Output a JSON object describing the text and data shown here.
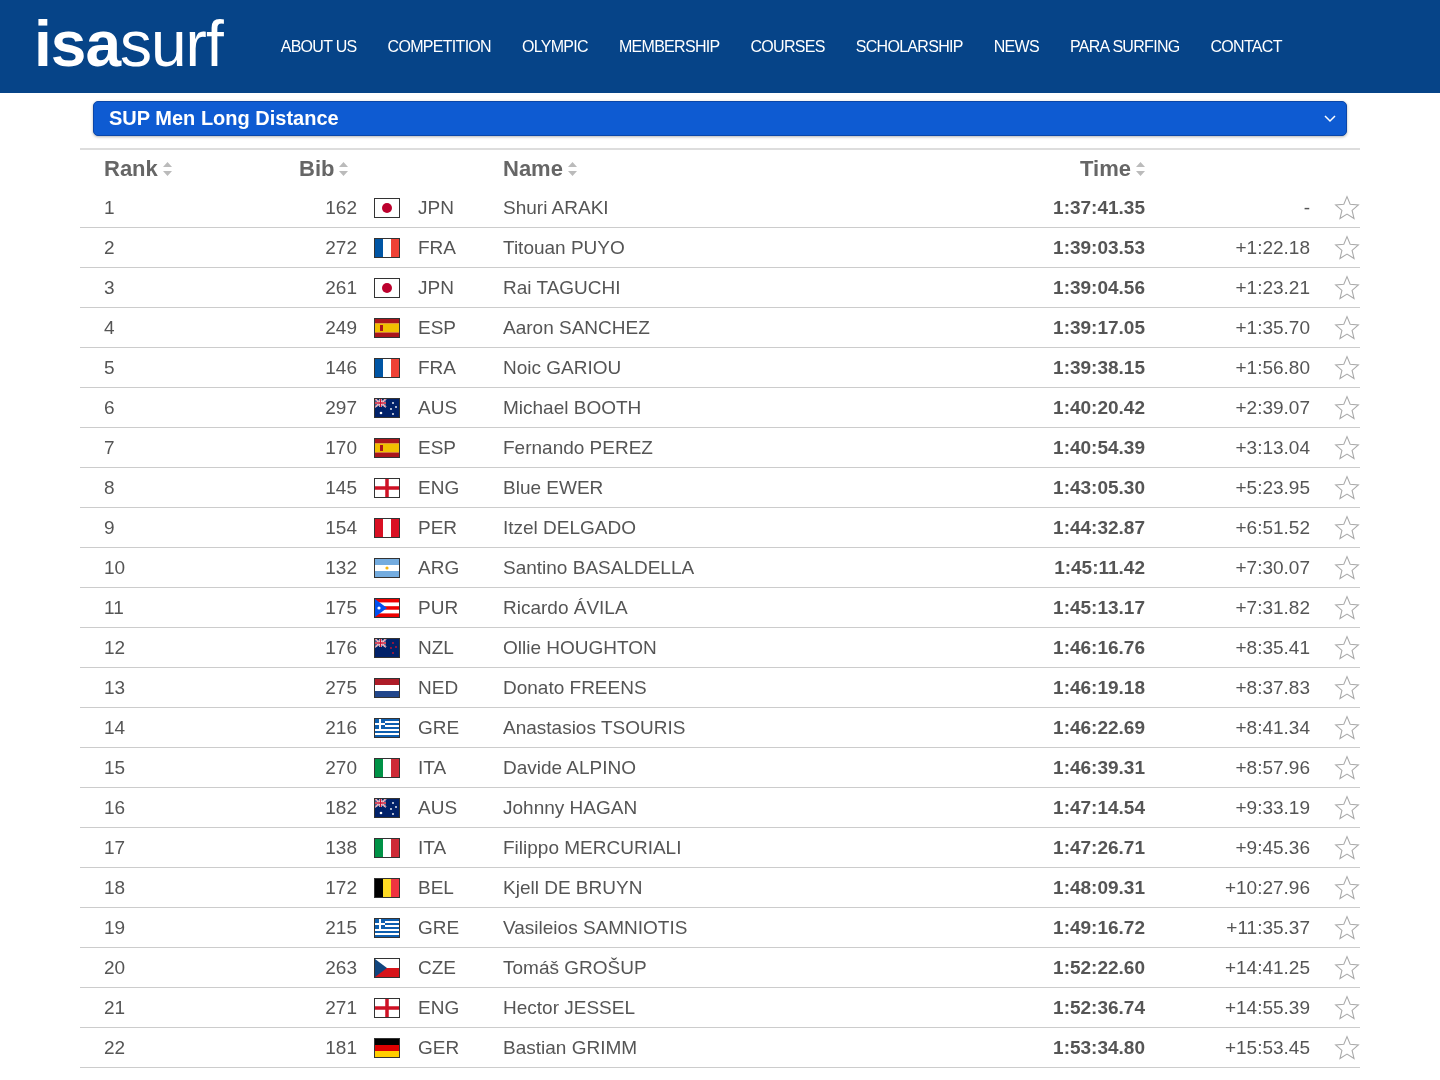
{
  "header": {
    "logo": "**isa**surf",
    "nav": [
      "ABOUT US",
      "COMPETITION",
      "OLYMPIC",
      "MEMBERSHIP",
      "COURSES",
      "SCHOLARSHIP",
      "NEWS",
      "PARA SURFING",
      "CONTACT"
    ]
  },
  "event_select": {
    "value": "SUP Men Long Distance"
  },
  "table": {
    "columns": [
      "Rank",
      "Bib",
      "Name",
      "Time"
    ],
    "rows": [
      {
        "rank": "1",
        "bib": "162",
        "kind": "jp",
        "country": "JPN",
        "name": "Shuri ARAKI",
        "time": "1:37:41.35",
        "gap": "-"
      },
      {
        "rank": "2",
        "bib": "272",
        "kind": "fr",
        "country": "FRA",
        "name": "Titouan PUYO",
        "time": "1:39:03.53",
        "gap": "+1:22.18"
      },
      {
        "rank": "3",
        "bib": "261",
        "kind": "jp",
        "country": "JPN",
        "name": "Rai TAGUCHI",
        "time": "1:39:04.56",
        "gap": "+1:23.21"
      },
      {
        "rank": "4",
        "bib": "249",
        "kind": "es",
        "country": "ESP",
        "name": "Aaron SANCHEZ",
        "time": "1:39:17.05",
        "gap": "+1:35.70"
      },
      {
        "rank": "5",
        "bib": "146",
        "kind": "fr",
        "country": "FRA",
        "name": "Noic GARIOU",
        "time": "1:39:38.15",
        "gap": "+1:56.80"
      },
      {
        "rank": "6",
        "bib": "297",
        "kind": "au",
        "country": "AUS",
        "name": "Michael BOOTH",
        "time": "1:40:20.42",
        "gap": "+2:39.07"
      },
      {
        "rank": "7",
        "bib": "170",
        "kind": "es",
        "country": "ESP",
        "name": "Fernando PEREZ",
        "time": "1:40:54.39",
        "gap": "+3:13.04"
      },
      {
        "rank": "8",
        "bib": "145",
        "kind": "en",
        "country": "ENG",
        "name": "Blue EWER",
        "time": "1:43:05.30",
        "gap": "+5:23.95"
      },
      {
        "rank": "9",
        "bib": "154",
        "kind": "pe",
        "country": "PER",
        "name": "Itzel DELGADO",
        "time": "1:44:32.87",
        "gap": "+6:51.52"
      },
      {
        "rank": "10",
        "bib": "132",
        "kind": "ar",
        "country": "ARG",
        "name": "Santino BASALDELLA",
        "time": "1:45:11.42",
        "gap": "+7:30.07"
      },
      {
        "rank": "11",
        "bib": "175",
        "kind": "pr",
        "country": "PUR",
        "name": "Ricardo ÁVILA",
        "time": "1:45:13.17",
        "gap": "+7:31.82"
      },
      {
        "rank": "12",
        "bib": "176",
        "kind": "nz",
        "country": "NZL",
        "name": "Ollie HOUGHTON",
        "time": "1:46:16.76",
        "gap": "+8:35.41"
      },
      {
        "rank": "13",
        "bib": "275",
        "kind": "nl",
        "country": "NED",
        "name": "Donato FREENS",
        "time": "1:46:19.18",
        "gap": "+8:37.83"
      },
      {
        "rank": "14",
        "bib": "216",
        "kind": "gr",
        "country": "GRE",
        "name": "Anastasios TSOURIS",
        "time": "1:46:22.69",
        "gap": "+8:41.34"
      },
      {
        "rank": "15",
        "bib": "270",
        "kind": "it",
        "country": "ITA",
        "name": "Davide ALPINO",
        "time": "1:46:39.31",
        "gap": "+8:57.96"
      },
      {
        "rank": "16",
        "bib": "182",
        "kind": "au",
        "country": "AUS",
        "name": "Johnny HAGAN",
        "time": "1:47:14.54",
        "gap": "+9:33.19"
      },
      {
        "rank": "17",
        "bib": "138",
        "kind": "it",
        "country": "ITA",
        "name": "Filippo MERCURIALI",
        "time": "1:47:26.71",
        "gap": "+9:45.36"
      },
      {
        "rank": "18",
        "bib": "172",
        "kind": "be",
        "country": "BEL",
        "name": "Kjell DE BRUYN",
        "time": "1:48:09.31",
        "gap": "+10:27.96"
      },
      {
        "rank": "19",
        "bib": "215",
        "kind": "gr",
        "country": "GRE",
        "name": "Vasileios SAMNIOTIS",
        "time": "1:49:16.72",
        "gap": "+11:35.37"
      },
      {
        "rank": "20",
        "bib": "263",
        "kind": "cz",
        "country": "CZE",
        "name": "Tomáš GROŠUP",
        "time": "1:52:22.60",
        "gap": "+14:41.25"
      },
      {
        "rank": "21",
        "bib": "271",
        "kind": "en",
        "country": "ENG",
        "name": "Hector JESSEL",
        "time": "1:52:36.74",
        "gap": "+14:55.39"
      },
      {
        "rank": "22",
        "bib": "181",
        "kind": "de",
        "country": "GER",
        "name": "Bastian GRIMM",
        "time": "1:53:34.80",
        "gap": "+15:53.45"
      }
    ]
  }
}
